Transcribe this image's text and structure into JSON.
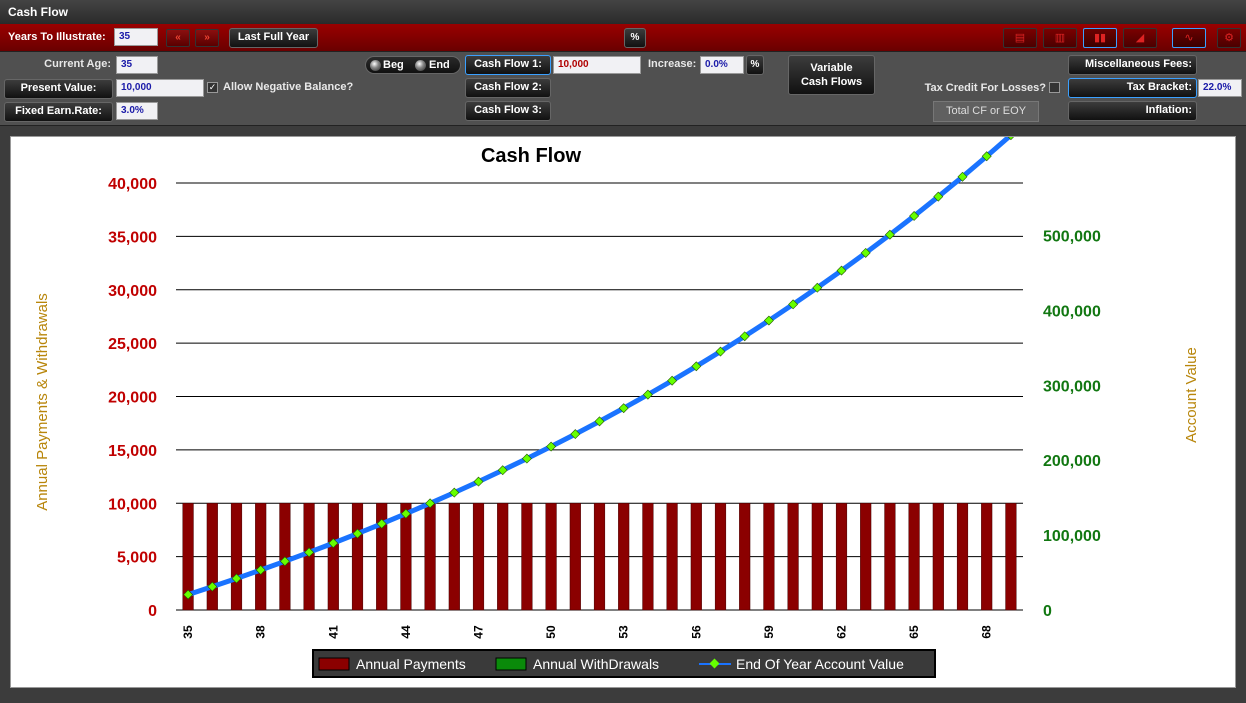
{
  "window": {
    "title": "Cash Flow"
  },
  "toolbar": {
    "years_label": "Years To Illustrate:",
    "years_value": "35",
    "prev_icon": "double-chevron-left-icon",
    "next_icon": "double-chevron-right-icon",
    "last_full_year_label": "Last Full Year",
    "percent_label": "%",
    "chart_views": [
      "table-icon",
      "bar-line-icon",
      "bar-chart-icon",
      "area-chart-icon",
      "line-chart-icon",
      "gear-icon"
    ]
  },
  "inputs": {
    "current_age_label": "Current Age:",
    "current_age_value": "35",
    "present_value_label": "Present Value:",
    "present_value_value": "10,000",
    "allow_negative_label": "Allow Negative Balance?",
    "allow_negative_checked": true,
    "fixed_earn_label": "Fixed Earn.Rate:",
    "fixed_earn_value": "3.0%",
    "beg_label": "Beg",
    "end_label": "End",
    "cash_flow_1_label": "Cash Flow 1:",
    "cash_flow_1_value": "10,000",
    "cash_flow_2_label": "Cash Flow 2:",
    "cash_flow_3_label": "Cash Flow 3:",
    "increase_label": "Increase:",
    "increase_value": "0.0%",
    "increase_unit": "%",
    "variable_cf_line1": "Variable",
    "variable_cf_line2": "Cash Flows",
    "tax_credit_label": "Tax Credit For Losses?",
    "total_cf_label": "Total CF or EOY",
    "misc_fees_label": "Miscellaneous Fees:",
    "tax_bracket_label": "Tax Bracket:",
    "tax_bracket_value": "22.0%",
    "inflation_label": "Inflation:"
  },
  "colors": {
    "payments": "#8b0000",
    "withdrawals": "#0a8a0a",
    "account_line": "#1a73ff",
    "account_marker": "#66ff00",
    "left_axis": "#c00000",
    "right_axis": "#117711",
    "axis_title": "#b8860b"
  },
  "chart_data": {
    "type": "bar",
    "title": "Cash Flow",
    "ylabel": "Annual Payments & Withdrawals",
    "y2label": "Account Value",
    "ylim": [
      0,
      40000
    ],
    "y2lim": [
      0,
      570000
    ],
    "yticks": [
      "0",
      "5,000",
      "10,000",
      "15,000",
      "20,000",
      "25,000",
      "30,000",
      "35,000",
      "40,000"
    ],
    "y2ticks": [
      "0",
      "100,000",
      "200,000",
      "300,000",
      "400,000",
      "500,000"
    ],
    "y2tick_values": [
      0,
      100000,
      200000,
      300000,
      400000,
      500000
    ],
    "x": [
      35,
      36,
      37,
      38,
      39,
      40,
      41,
      42,
      43,
      44,
      45,
      46,
      47,
      48,
      49,
      50,
      51,
      52,
      53,
      54,
      55,
      56,
      57,
      58,
      59,
      60,
      61,
      62,
      63,
      64,
      65,
      66,
      67,
      68,
      69
    ],
    "xtick_labels": [
      "35",
      "38",
      "41",
      "44",
      "47",
      "50",
      "53",
      "56",
      "59",
      "62",
      "65",
      "68"
    ],
    "grid": true,
    "legend_position": "bottom",
    "series": [
      {
        "name": "Annual Payments",
        "type": "bar",
        "values": [
          10000,
          10000,
          10000,
          10000,
          10000,
          10000,
          10000,
          10000,
          10000,
          10000,
          10000,
          10000,
          10000,
          10000,
          10000,
          10000,
          10000,
          10000,
          10000,
          10000,
          10000,
          10000,
          10000,
          10000,
          10000,
          10000,
          10000,
          10000,
          10000,
          10000,
          10000,
          10000,
          10000,
          10000,
          10000
        ]
      },
      {
        "name": "Annual WithDrawals",
        "type": "bar",
        "values": [
          0,
          0,
          0,
          0,
          0,
          0,
          0,
          0,
          0,
          0,
          0,
          0,
          0,
          0,
          0,
          0,
          0,
          0,
          0,
          0,
          0,
          0,
          0,
          0,
          0,
          0,
          0,
          0,
          0,
          0,
          0,
          0,
          0,
          0,
          0
        ]
      },
      {
        "name": "End Of Year Account Value",
        "type": "line",
        "axis": "right",
        "values": [
          20600,
          31200,
          42100,
          53400,
          65000,
          77000,
          89300,
          102000,
          115100,
          128500,
          142400,
          156700,
          171400,
          186600,
          202100,
          218200,
          234800,
          251800,
          269400,
          287500,
          306100,
          325300,
          345000,
          365400,
          386400,
          408000,
          430200,
          453100,
          476700,
          501000,
          526000,
          551800,
          578300,
          605700,
          633900
        ]
      }
    ]
  }
}
